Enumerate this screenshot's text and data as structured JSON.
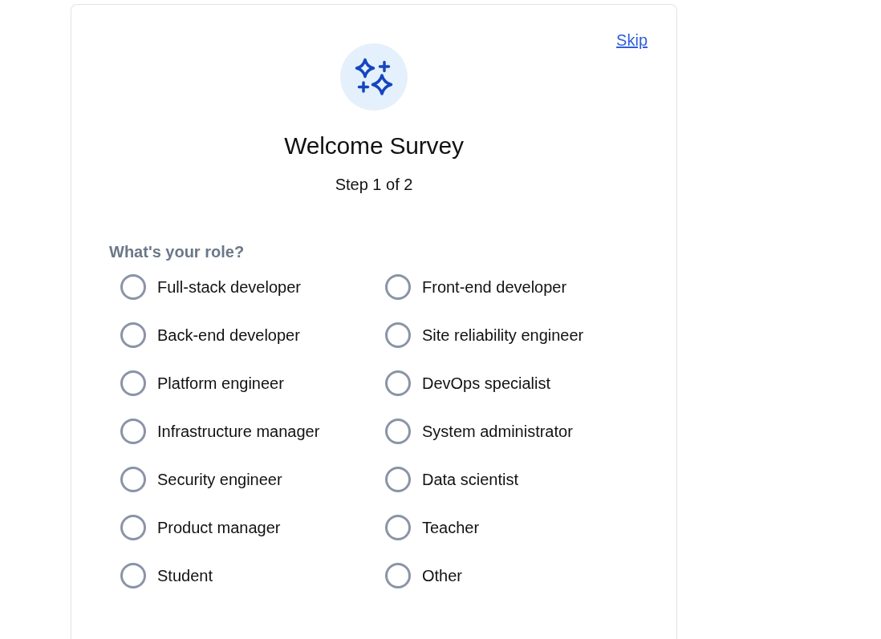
{
  "skip_link": "Skip",
  "title": "Welcome Survey",
  "step": "Step 1 of 2",
  "question": {
    "label": "What's your role?",
    "options": [
      {
        "label": "Full-stack developer",
        "selected": false
      },
      {
        "label": "Front-end developer",
        "selected": false
      },
      {
        "label": "Back-end developer",
        "selected": false
      },
      {
        "label": "Site reliability engineer",
        "selected": false
      },
      {
        "label": "Platform engineer",
        "selected": false
      },
      {
        "label": "DevOps specialist",
        "selected": false
      },
      {
        "label": "Infrastructure manager",
        "selected": false
      },
      {
        "label": "System administrator",
        "selected": false
      },
      {
        "label": "Security engineer",
        "selected": false
      },
      {
        "label": "Data scientist",
        "selected": false
      },
      {
        "label": "Product manager",
        "selected": false
      },
      {
        "label": "Teacher",
        "selected": false
      },
      {
        "label": "Student",
        "selected": false
      },
      {
        "label": "Other",
        "selected": false
      }
    ]
  }
}
